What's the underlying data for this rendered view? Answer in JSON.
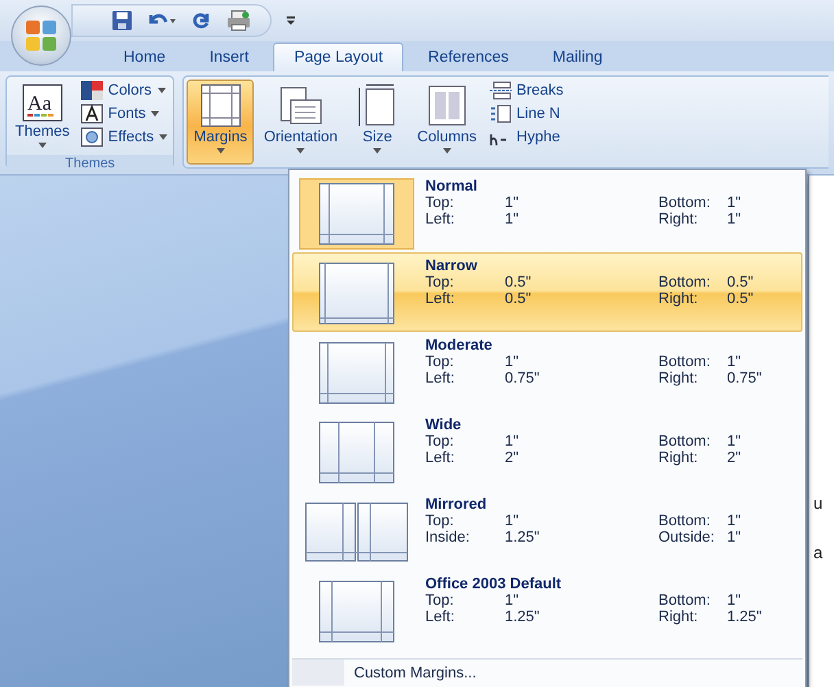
{
  "tabs": [
    {
      "label": "Home",
      "selected": false
    },
    {
      "label": "Insert",
      "selected": false
    },
    {
      "label": "Page Layout",
      "selected": true
    },
    {
      "label": "References",
      "selected": false
    },
    {
      "label": "Mailing",
      "selected": false
    }
  ],
  "themes_group": {
    "label": "Themes",
    "icon_text": "Aa",
    "big_button": "Themes",
    "small_buttons": [
      "Colors",
      "Fonts",
      "Effects"
    ]
  },
  "page_setup_group": {
    "big_buttons": [
      {
        "label": "Margins",
        "selected": true
      },
      {
        "label": "Orientation",
        "selected": false
      },
      {
        "label": "Size",
        "selected": false
      },
      {
        "label": "Columns",
        "selected": false
      }
    ],
    "small_buttons": [
      "Breaks",
      "Line N",
      "Hyphe"
    ]
  },
  "margins_menu": {
    "items": [
      {
        "name": "Normal",
        "kind": "single",
        "current": true,
        "selected": false,
        "rows": [
          {
            "label": "Top:",
            "value": "1\"",
            "label2": "Bottom:",
            "value2": "1\""
          },
          {
            "label": "Left:",
            "value": "1\"",
            "label2": "Right:",
            "value2": "1\""
          }
        ]
      },
      {
        "name": "Narrow",
        "kind": "single",
        "current": false,
        "selected": true,
        "rows": [
          {
            "label": "Top:",
            "value": "0.5\"",
            "label2": "Bottom:",
            "value2": "0.5\""
          },
          {
            "label": "Left:",
            "value": "0.5\"",
            "label2": "Right:",
            "value2": "0.5\""
          }
        ]
      },
      {
        "name": "Moderate",
        "kind": "single",
        "current": false,
        "selected": false,
        "rows": [
          {
            "label": "Top:",
            "value": "1\"",
            "label2": "Bottom:",
            "value2": "1\""
          },
          {
            "label": "Left:",
            "value": "0.75\"",
            "label2": "Right:",
            "value2": "0.75\""
          }
        ]
      },
      {
        "name": "Wide",
        "kind": "single",
        "current": false,
        "selected": false,
        "rows": [
          {
            "label": "Top:",
            "value": "1\"",
            "label2": "Bottom:",
            "value2": "1\""
          },
          {
            "label": "Left:",
            "value": "2\"",
            "label2": "Right:",
            "value2": "2\""
          }
        ]
      },
      {
        "name": "Mirrored",
        "kind": "mirrored",
        "current": false,
        "selected": false,
        "rows": [
          {
            "label": "Top:",
            "value": "1\"",
            "label2": "Bottom:",
            "value2": "1\""
          },
          {
            "label": "Inside:",
            "value": "1.25\"",
            "label2": "Outside:",
            "value2": "1\""
          }
        ]
      },
      {
        "name": "Office 2003 Default",
        "kind": "single",
        "current": false,
        "selected": false,
        "rows": [
          {
            "label": "Top:",
            "value": "1\"",
            "label2": "Bottom:",
            "value2": "1\""
          },
          {
            "label": "Left:",
            "value": "1.25\"",
            "label2": "Right:",
            "value2": "1.25\""
          }
        ]
      }
    ],
    "footer": "Custom Margins..."
  },
  "document_text": [
    "u",
    "a"
  ]
}
